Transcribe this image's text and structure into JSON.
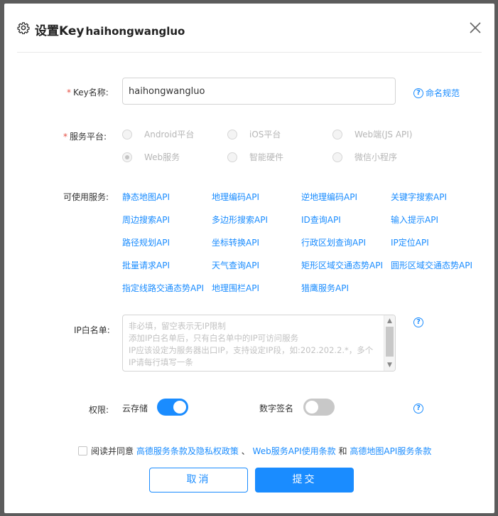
{
  "header": {
    "title": "设置Key",
    "key_name": "haihongwangluo"
  },
  "form": {
    "key_name": {
      "label": "Key名称:",
      "required_mark": "*",
      "value": "haihongwangluo",
      "help": "命名规范"
    },
    "platform": {
      "label": "服务平台:",
      "required_mark": "*",
      "options": [
        {
          "label": "Android平台",
          "selected": false
        },
        {
          "label": "iOS平台",
          "selected": false
        },
        {
          "label": "Web端(JS API)",
          "selected": false
        },
        {
          "label": "Web服务",
          "selected": true
        },
        {
          "label": "智能硬件",
          "selected": false
        },
        {
          "label": "微信小程序",
          "selected": false
        }
      ]
    },
    "services": {
      "label": "可使用服务:",
      "items": [
        "静态地图API",
        "地理编码API",
        "逆地理编码API",
        "关键字搜索API",
        "周边搜索API",
        "多边形搜索API",
        "ID查询API",
        "输入提示API",
        "路径规划API",
        "坐标转换API",
        "行政区划查询API",
        "IP定位API",
        "批量请求API",
        "天气查询API",
        "矩形区域交通态势API",
        "圆形区域交通态势API",
        "指定线路交通态势API",
        "地理围栏API",
        "猎鹰服务API"
      ]
    },
    "ip_whitelist": {
      "label": "IP白名单:",
      "placeholder": "非必填，留空表示无IP限制\n添加IP白名单后，只有白名单中的IP可访问服务\nIP应该设定为服务器出口IP，支持设定IP段，如:202.202.2.*，多个IP请每行填写一条"
    },
    "permissions": {
      "label": "权限:",
      "cloud_storage": {
        "label": "云存储",
        "on": true
      },
      "digital_signature": {
        "label": "数字签名",
        "on": false
      }
    }
  },
  "agreement": {
    "prefix": "阅读并同意",
    "link1": "高德服务条款及隐私权政策",
    "sep": "、",
    "link2": "Web服务API使用条款",
    "and": "和",
    "link3": "高德地图API服务条款"
  },
  "buttons": {
    "cancel": "取消",
    "submit": "提交"
  },
  "colors": {
    "accent": "#1a8cff",
    "required": "#e54d42"
  }
}
